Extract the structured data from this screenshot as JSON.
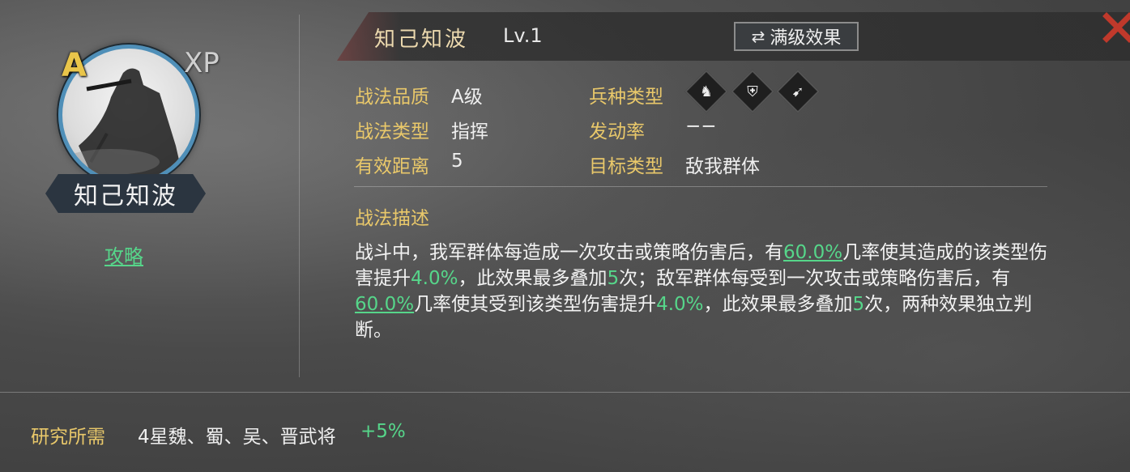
{
  "portrait": {
    "grade": "A",
    "xp_label": "XP",
    "name": "知己知波",
    "guide_link": "攻略"
  },
  "header": {
    "title": "知己知波",
    "level": "Lv.1",
    "max_button_label": "满级效果",
    "icons": [
      "swap-icon",
      "close-icon"
    ]
  },
  "attributes": {
    "quality_label": "战法品质",
    "quality_value": "A级",
    "type_label": "战法类型",
    "type_value": "指挥",
    "range_label": "有效距离",
    "range_value": "5",
    "troop_label": "兵种类型",
    "troop_icons": [
      "cavalry-icon",
      "shield-icon",
      "bow-icon"
    ],
    "rate_label": "发动率",
    "rate_value": "−−",
    "target_label": "目标类型",
    "target_value": "敌我群体"
  },
  "description": {
    "heading": "战法描述",
    "p1": "战斗中，我军群体每造成一次攻击或策略伤害后，有",
    "v1": "60.0%",
    "p2": "几率使其造成的该类型伤害提升",
    "v2": "4.0%",
    "p3": "，此效果最多叠加",
    "v3": "5",
    "p4": "次；敌军群体每受到一次攻击或策略伤害后，有",
    "v4": "60.0%",
    "p5": "几率使其受到该类型伤害提升",
    "v5": "4.0%",
    "p6": "，此效果最多叠加",
    "v6": "5",
    "p7": "次，两种效果独立判断。"
  },
  "research": {
    "label": "研究所需",
    "value": "4星魏、蜀、吴、晋武将",
    "bonus": "+5%"
  },
  "colors": {
    "gold": "#e9c86a",
    "green": "#56d68a",
    "close_red": "#c0392b",
    "frame_blue": "#4f8fb8"
  }
}
